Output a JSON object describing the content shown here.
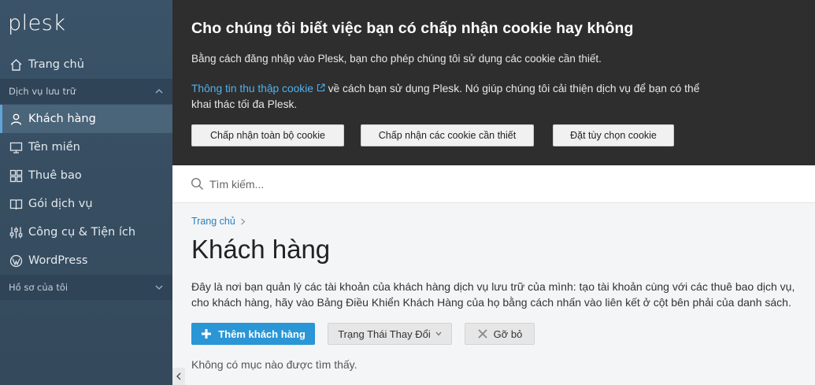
{
  "brand": "plesk",
  "sidebar": {
    "home": "Trang chủ",
    "section_hosting": "Dịch vụ lưu trữ",
    "items": [
      {
        "label": "Khách hàng",
        "icon": "user-icon"
      },
      {
        "label": "Tên miền",
        "icon": "monitor-icon"
      },
      {
        "label": "Thuê bao",
        "icon": "grid-icon"
      },
      {
        "label": "Gói dịch vụ",
        "icon": "book-icon"
      },
      {
        "label": "Công cụ & Tiện ích",
        "icon": "sliders-icon"
      },
      {
        "label": "WordPress",
        "icon": "wordpress-icon"
      }
    ],
    "section_profile": "Hồ sơ của tôi"
  },
  "cookie": {
    "title": "Cho chúng tôi biết việc bạn có chấp nhận cookie hay không",
    "text1": "Bằng cách đăng nhập vào Plesk, bạn cho phép chúng tôi sử dụng các cookie cần thiết.",
    "link": "Thông tin thu thập cookie",
    "text2": " về cách bạn sử dụng Plesk. Nó giúp chúng tôi cải thiện dịch vụ để bạn có thể khai thác tối đa Plesk.",
    "btn_accept_all": "Chấp nhận toàn bộ cookie",
    "btn_accept_required": "Chấp nhận các cookie cần thiết",
    "btn_customize": "Đặt tùy chọn cookie"
  },
  "search": {
    "placeholder": "Tìm kiếm..."
  },
  "main": {
    "breadcrumb": "Trang chủ",
    "title": "Khách hàng",
    "desc_line1": "Đây là nơi bạn quản lý các tài khoản của khách hàng dịch vụ lưu trữ của mình: tạo tài khoản cùng với các thuê bao dịch vụ,",
    "desc_line2": "cho khách hàng, hãy vào Bảng Điều Khiển Khách Hàng của họ bằng cách nhấn vào liên kết ở cột bên phải của danh sách.",
    "btn_add": "Thêm khách hàng",
    "btn_status": "Trạng Thái Thay Đổi",
    "btn_remove": "Gỡ bỏ",
    "empty": "Không có mục nào được tìm thấy."
  },
  "colors": {
    "accent": "#2a96d6",
    "link": "#2a7fc0",
    "sidebar_bg": "#3a5368",
    "banner_bg": "#2e2e2e"
  }
}
